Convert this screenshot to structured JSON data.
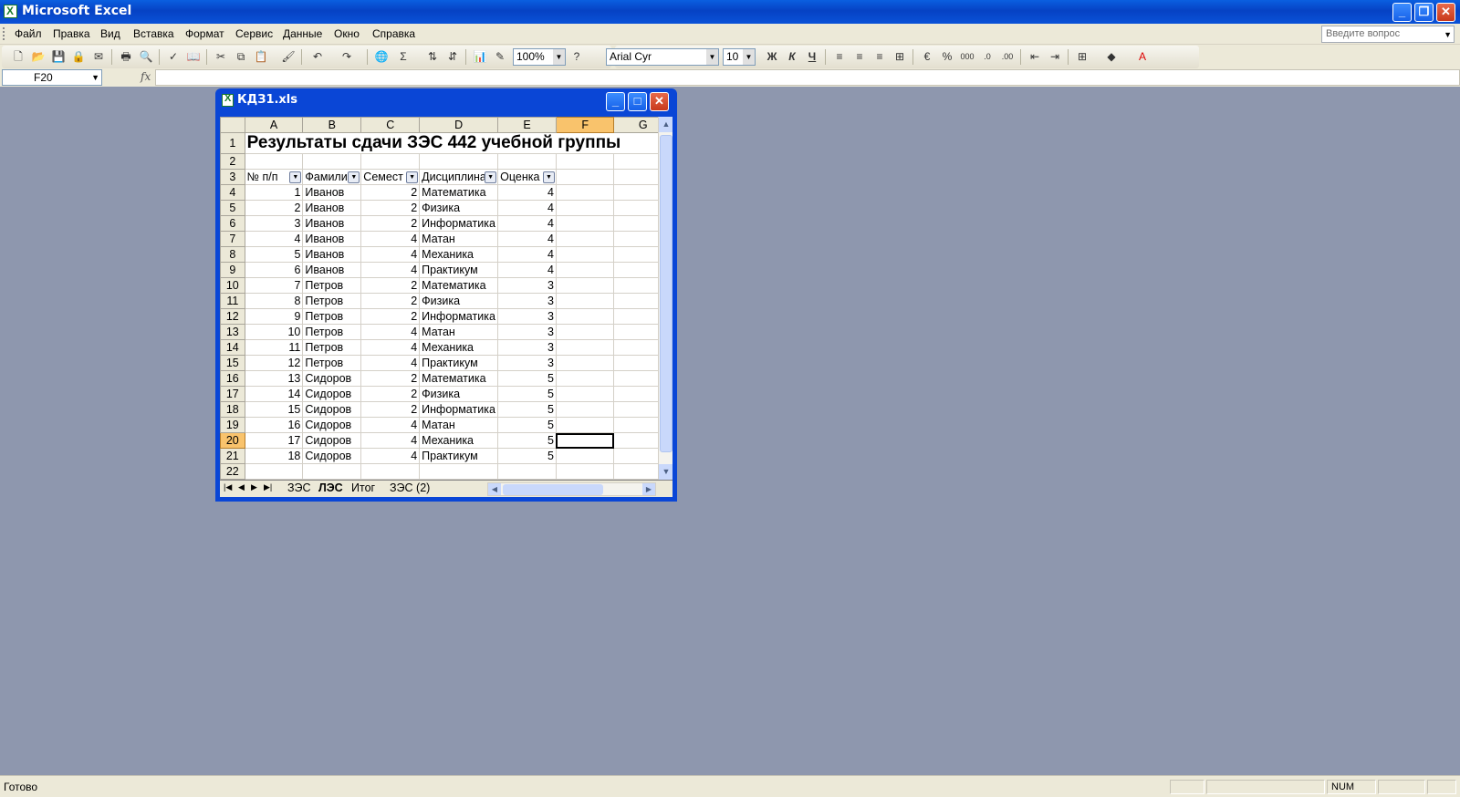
{
  "app": {
    "title": "Microsoft Excel"
  },
  "menu": [
    "Файл",
    "Правка",
    "Вид",
    "Вставка",
    "Формат",
    "Сервис",
    "Данные",
    "Окно",
    "Справка"
  ],
  "help_placeholder": "Введите вопрос",
  "toolbar": {
    "zoom": "100%",
    "font": "Arial Cyr",
    "size": "10",
    "bold": "Ж",
    "italic": "К",
    "underline": "Ч"
  },
  "formula": {
    "cell_ref": "F20",
    "fx": "fx",
    "value": ""
  },
  "workbook": {
    "title": "КДЗ1.xls"
  },
  "sheet": {
    "columns": [
      "A",
      "B",
      "C",
      "D",
      "E",
      "F",
      "G"
    ],
    "title": "Результаты сдачи ЗЭС 442 учебной группы",
    "headers": [
      "№ п/п",
      "Фамили",
      "Семест",
      "Дисциплина",
      "Оценка"
    ],
    "rows": [
      [
        "1",
        "Иванов",
        "2",
        "Математика",
        "4"
      ],
      [
        "2",
        "Иванов",
        "2",
        "Физика",
        "4"
      ],
      [
        "3",
        "Иванов",
        "2",
        "Информатика",
        "4"
      ],
      [
        "4",
        "Иванов",
        "4",
        "Матан",
        "4"
      ],
      [
        "5",
        "Иванов",
        "4",
        "Механика",
        "4"
      ],
      [
        "6",
        "Иванов",
        "4",
        "Практикум",
        "4"
      ],
      [
        "7",
        "Петров",
        "2",
        "Математика",
        "3"
      ],
      [
        "8",
        "Петров",
        "2",
        "Физика",
        "3"
      ],
      [
        "9",
        "Петров",
        "2",
        "Информатика",
        "3"
      ],
      [
        "10",
        "Петров",
        "4",
        "Матан",
        "3"
      ],
      [
        "11",
        "Петров",
        "4",
        "Механика",
        "3"
      ],
      [
        "12",
        "Петров",
        "4",
        "Практикум",
        "3"
      ],
      [
        "13",
        "Сидоров",
        "2",
        "Математика",
        "5"
      ],
      [
        "14",
        "Сидоров",
        "2",
        "Физика",
        "5"
      ],
      [
        "15",
        "Сидоров",
        "2",
        "Информатика",
        "5"
      ],
      [
        "16",
        "Сидоров",
        "4",
        "Матан",
        "5"
      ],
      [
        "17",
        "Сидоров",
        "4",
        "Механика",
        "5"
      ],
      [
        "18",
        "Сидоров",
        "4",
        "Практикум",
        "5"
      ]
    ],
    "selected": "F20"
  },
  "tabs": [
    "ЗЭС",
    "ЛЭС",
    "Итог",
    "ЗЭС (2)"
  ],
  "active_tab": "ЛЭС",
  "status": {
    "text": "Готово",
    "num": "NUM"
  }
}
